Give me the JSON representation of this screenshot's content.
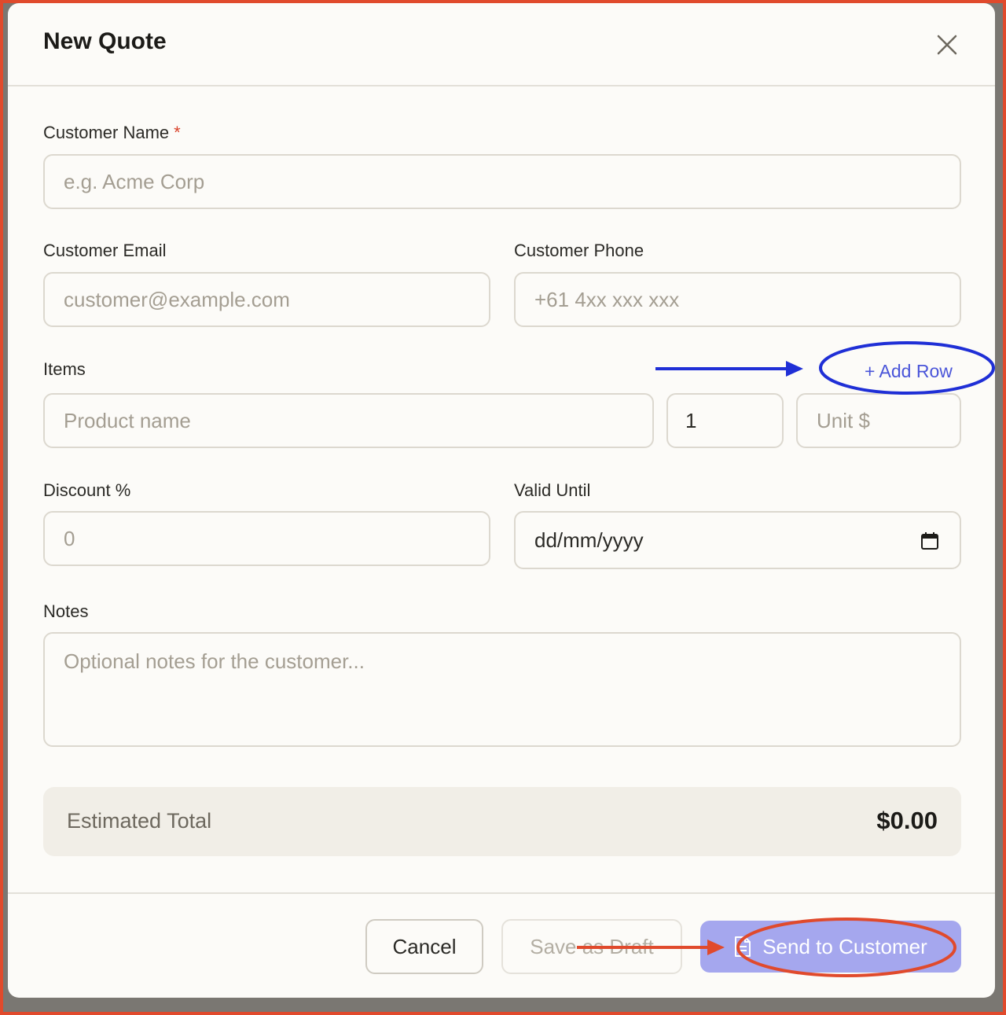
{
  "modal": {
    "title": "New Quote",
    "close_icon": "close-icon"
  },
  "form": {
    "customer_name": {
      "label": "Customer Name",
      "required_mark": "*",
      "placeholder": "e.g. Acme Corp"
    },
    "customer_email": {
      "label": "Customer Email",
      "placeholder": "customer@example.com"
    },
    "customer_phone": {
      "label": "Customer Phone",
      "placeholder": "+61 4xx xxx xxx"
    },
    "items": {
      "label": "Items",
      "add_row_label": "+ Add Row",
      "product_placeholder": "Product name",
      "quantity_value": "1",
      "unit_price_placeholder": "Unit $"
    },
    "discount": {
      "label": "Discount %",
      "placeholder": "0"
    },
    "valid_until": {
      "label": "Valid Until",
      "value": "dd/mm/yyyy",
      "icon": "calendar-icon"
    },
    "notes": {
      "label": "Notes",
      "placeholder": "Optional notes for the customer..."
    }
  },
  "summary": {
    "label": "Estimated Total",
    "value": "$0.00"
  },
  "footer": {
    "cancel_label": "Cancel",
    "draft_label": "Save as Draft",
    "send_label": "Send to Customer",
    "send_icon": "document-icon"
  },
  "colors": {
    "accent": "#a5a7ee",
    "required": "#d9432b",
    "annotation_blue": "#1f2fd6",
    "annotation_red": "#e04a2c"
  }
}
